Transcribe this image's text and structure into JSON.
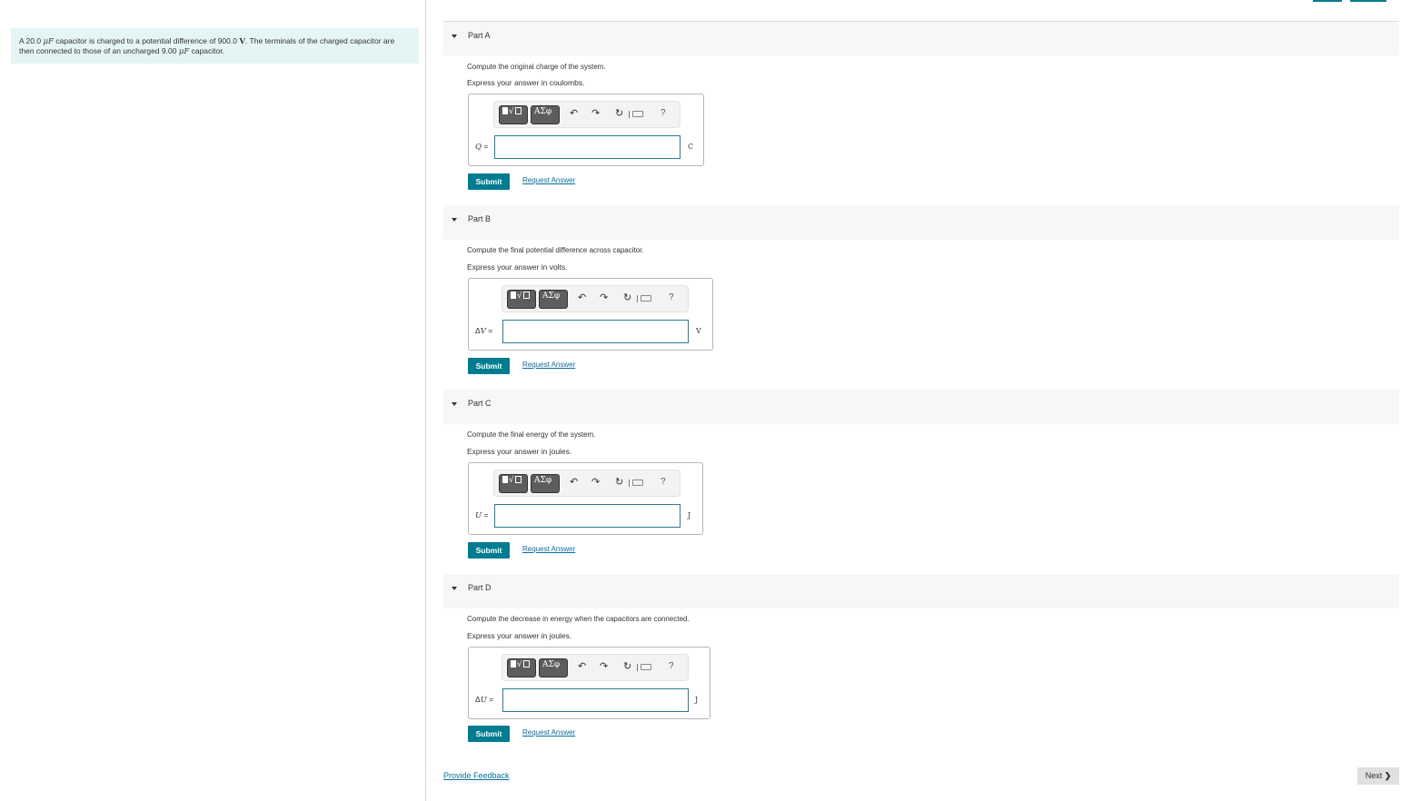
{
  "problem": {
    "text_parts": [
      {
        "t": "A 20.0 ",
        "style": "plain"
      },
      {
        "t": "μF",
        "style": "math"
      },
      {
        "t": " capacitor is charged to a potential difference of 900.0 ",
        "style": "plain"
      },
      {
        "t": "V",
        "style": "mathbold"
      },
      {
        "t": ". The terminals of the charged capacitor are then connected to those of an uncharged 9.00 ",
        "style": "plain"
      },
      {
        "t": "μF",
        "style": "math"
      },
      {
        "t": " capacitor.",
        "style": "plain"
      }
    ]
  },
  "toolbar": {
    "templates_label": "√",
    "greek_label": "ΑΣφ",
    "undo_icon": "↶",
    "redo_icon": "↷",
    "reset_icon": "↻",
    "help_label": "?"
  },
  "parts": [
    {
      "title": "Part A",
      "question": "Compute the original charge of the system.",
      "express": "Express your answer in coulombs.",
      "var_prefix": "",
      "var": "Q",
      "equals": " =",
      "unit": "C",
      "input_value": "",
      "submit": "Submit",
      "request": "Request Answer"
    },
    {
      "title": "Part B",
      "question": "Compute the final potential difference across capacitor.",
      "express": "Express your answer in volts.",
      "var_prefix": "Δ",
      "var": "V",
      "equals": " =",
      "unit": "V",
      "input_value": "",
      "submit": "Submit",
      "request": "Request Answer"
    },
    {
      "title": "Part C",
      "question": "Compute the final energy of the system.",
      "express": "Express your answer in joules.",
      "var_prefix": "",
      "var": "U",
      "equals": " =",
      "unit": "J",
      "input_value": "",
      "submit": "Submit",
      "request": "Request Answer"
    },
    {
      "title": "Part D",
      "question": "Compute the decrease in energy when the capacitors are connected.",
      "express": "Express your answer in joules.",
      "var_prefix": "Δ",
      "var": "U",
      "equals": " =",
      "unit": "J",
      "input_value": "",
      "submit": "Submit",
      "request": "Request Answer"
    }
  ],
  "footer": {
    "feedback": "Provide Feedback",
    "next": "Next",
    "next_icon": "❯"
  }
}
